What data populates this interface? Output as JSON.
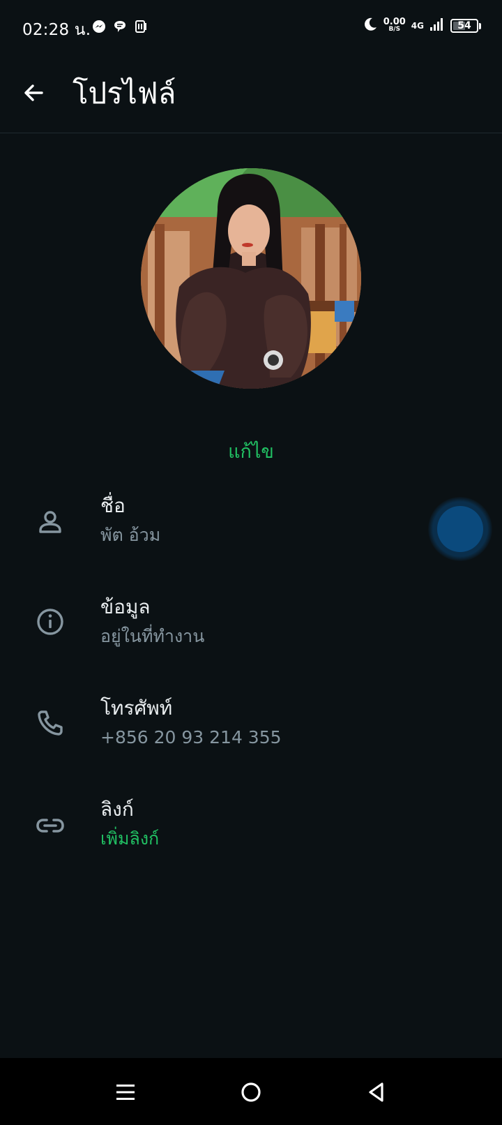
{
  "status_bar": {
    "time": "02:28 น.",
    "net_speed_value": "0.00",
    "net_speed_unit": "B/S",
    "network_type": "4G",
    "battery": "54",
    "battery_level": 0.54,
    "left_icons": [
      "messenger-icon",
      "chat-bubble-icon",
      "app-notification-icon"
    ],
    "right_icons": [
      "moon-icon",
      "signal-icon",
      "battery-icon"
    ]
  },
  "app_bar": {
    "title": "โปรไฟล์",
    "back_icon": "arrow-left-icon"
  },
  "profile": {
    "edit_label": "แก้ไข"
  },
  "rows": [
    {
      "icon": "person-icon",
      "label": "ชื่อ",
      "value": "พัต อ้วม"
    },
    {
      "icon": "info-icon",
      "label": "ข้อมูล",
      "value": "อยู่ในที่ทำงาน"
    },
    {
      "icon": "phone-icon",
      "label": "โทรศัพท์",
      "value": "+856 20 93 214 355"
    },
    {
      "icon": "link-icon",
      "label": "ลิงก์",
      "value": "เพิ่มลิงก์"
    }
  ],
  "colors": {
    "background": "#0b1114",
    "accent": "#21c063",
    "secondary_text": "#8696a0",
    "primary_text": "#e9edef"
  },
  "nav_bar": {
    "buttons": [
      "menu-icon",
      "home-icon",
      "back-triangle-icon"
    ]
  }
}
